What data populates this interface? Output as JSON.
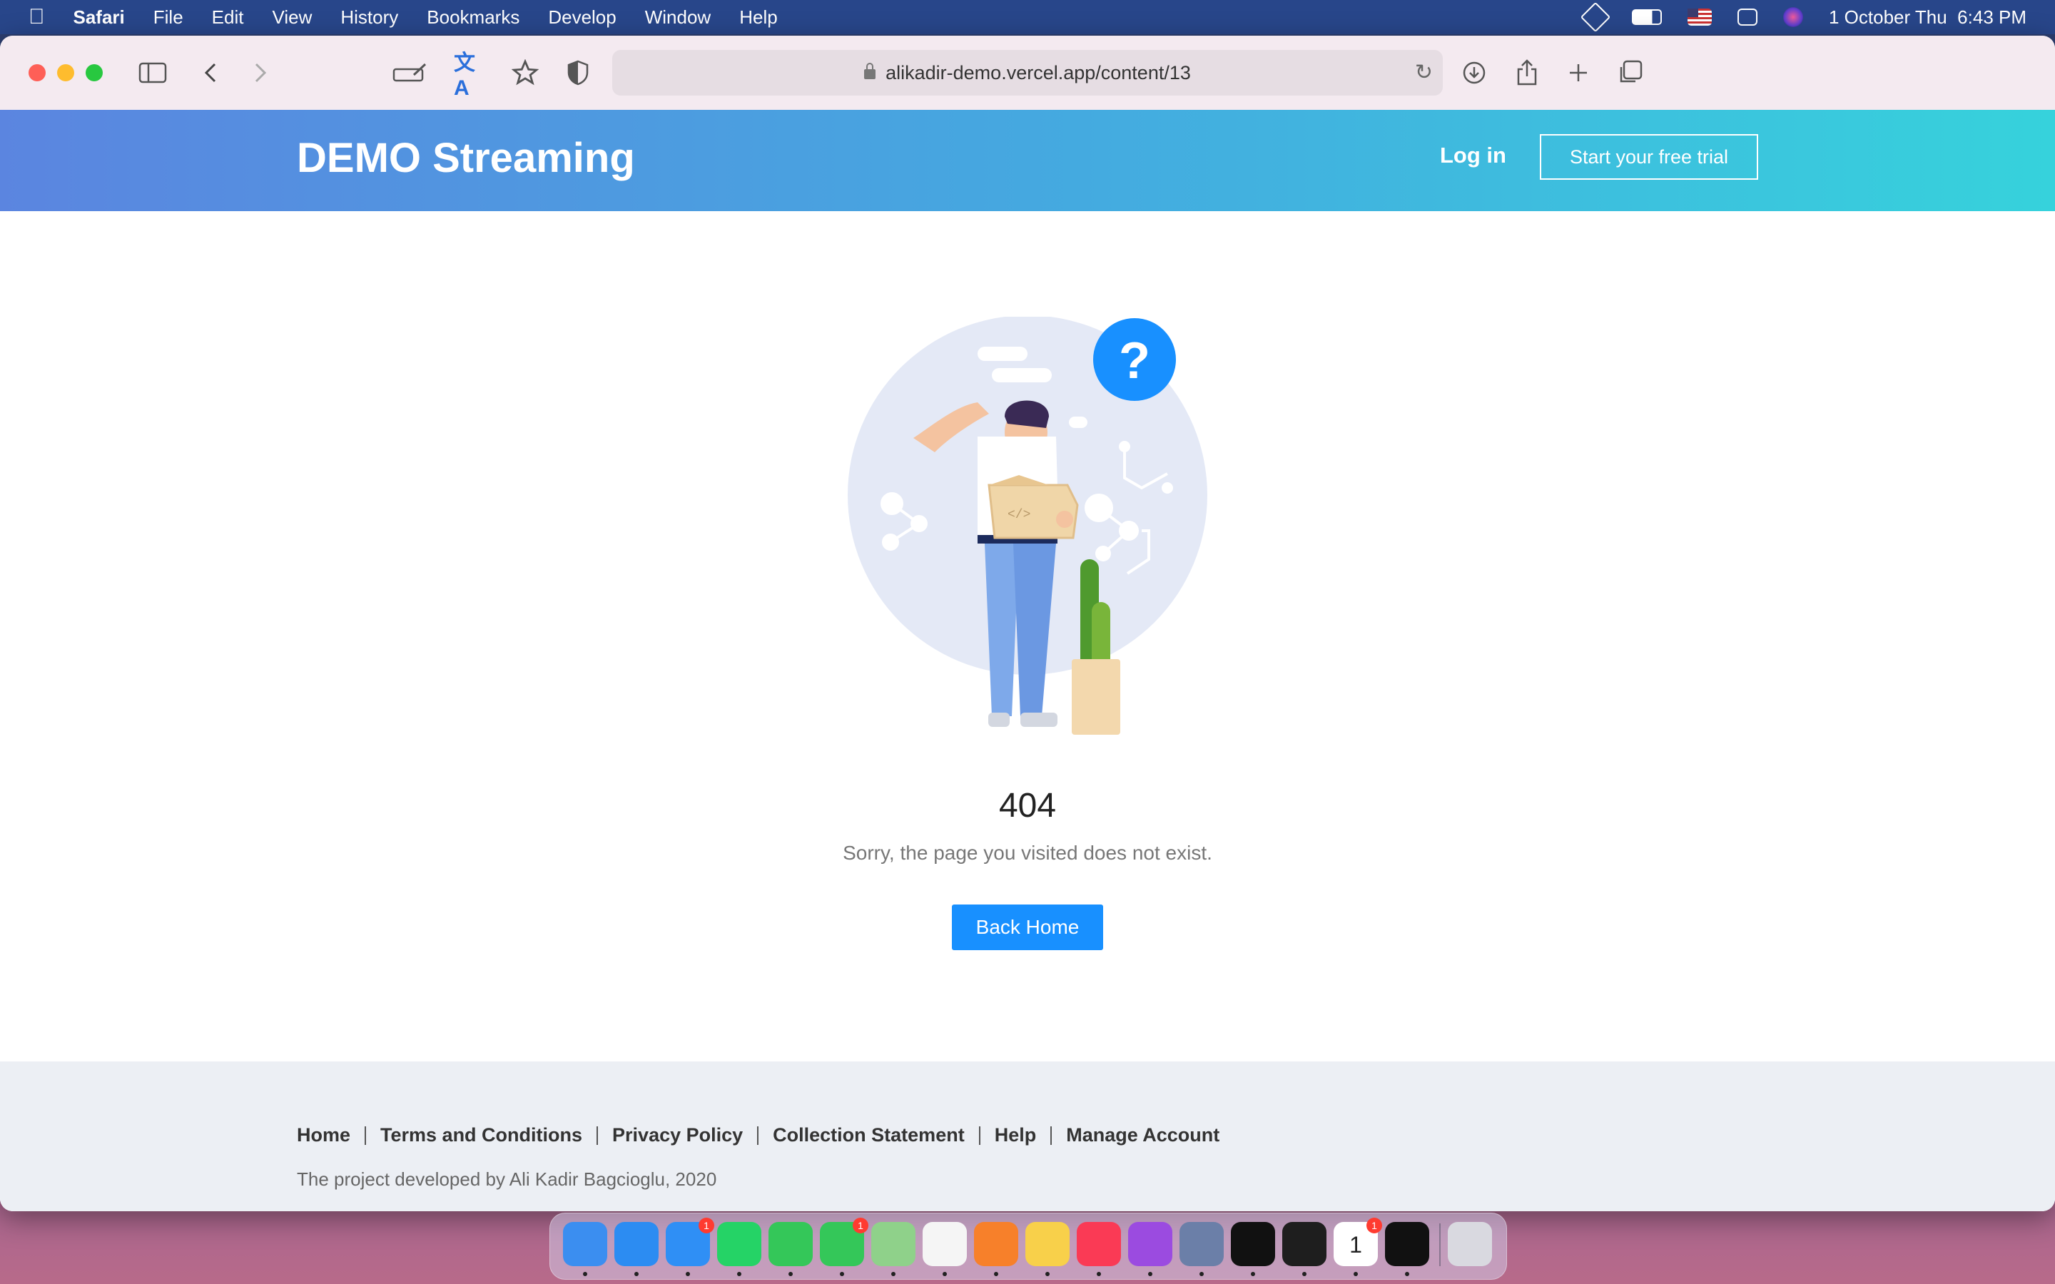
{
  "menubar": {
    "apple": "",
    "app": "Safari",
    "items": [
      "File",
      "Edit",
      "View",
      "History",
      "Bookmarks",
      "Develop",
      "Window",
      "Help"
    ],
    "clock": "1 October Thu  6:43 PM"
  },
  "browser": {
    "url": "alikadir-demo.vercel.app/content/13"
  },
  "site": {
    "brand": "DEMO Streaming",
    "login": "Log in",
    "trial": "Start your free trial"
  },
  "error": {
    "code": "404",
    "message": "Sorry, the page you visited does not exist.",
    "button": "Back Home"
  },
  "footer": {
    "links": [
      "Home",
      "Terms and Conditions",
      "Privacy Policy",
      "Collection Statement",
      "Help",
      "Manage Account"
    ],
    "copyright": "The project developed by Ali Kadir Bagcioglu, 2020"
  },
  "dock": {
    "apps": [
      {
        "name": "finder-icon",
        "color": "#3b8ef0"
      },
      {
        "name": "safari-icon",
        "color": "#2c8cf2"
      },
      {
        "name": "mail-icon",
        "color": "#2f8ff5",
        "badge": "1"
      },
      {
        "name": "whatsapp-icon",
        "color": "#25d366"
      },
      {
        "name": "facetime-icon",
        "color": "#34c759"
      },
      {
        "name": "messages-icon",
        "color": "#34c759",
        "badge": "1"
      },
      {
        "name": "maps-icon",
        "color": "#8fd18a"
      },
      {
        "name": "reminders-icon",
        "color": "#f5f5f5"
      },
      {
        "name": "launchpad-icon",
        "color": "#f7802a"
      },
      {
        "name": "notes-icon",
        "color": "#f8d04a"
      },
      {
        "name": "music-icon",
        "color": "#fa3a55"
      },
      {
        "name": "podcasts-icon",
        "color": "#9b4be0"
      },
      {
        "name": "preview-icon",
        "color": "#6b7fa8"
      },
      {
        "name": "webstorm-icon",
        "color": "#111"
      },
      {
        "name": "figma-icon",
        "color": "#1e1e1e"
      },
      {
        "name": "calendar-icon",
        "color": "#ffffff",
        "badge": "1",
        "label": "1"
      },
      {
        "name": "terminal-icon",
        "color": "#111"
      },
      {
        "name": "trash-icon",
        "color": "#d9d9e0"
      }
    ]
  }
}
